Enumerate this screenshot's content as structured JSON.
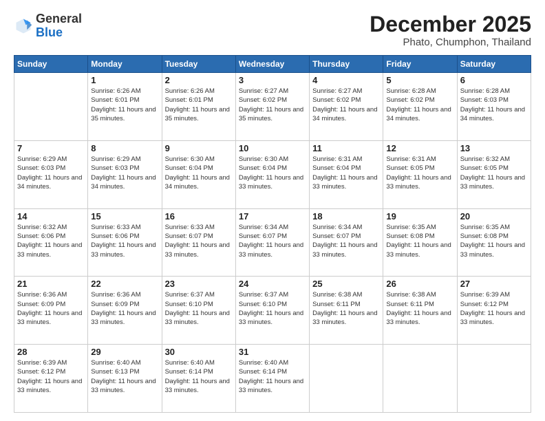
{
  "header": {
    "logo_general": "General",
    "logo_blue": "Blue",
    "month": "December 2025",
    "location": "Phato, Chumphon, Thailand"
  },
  "days_of_week": [
    "Sunday",
    "Monday",
    "Tuesday",
    "Wednesday",
    "Thursday",
    "Friday",
    "Saturday"
  ],
  "weeks": [
    [
      {
        "day": "",
        "sunrise": "",
        "sunset": "",
        "daylight": ""
      },
      {
        "day": "1",
        "sunrise": "Sunrise: 6:26 AM",
        "sunset": "Sunset: 6:01 PM",
        "daylight": "Daylight: 11 hours and 35 minutes."
      },
      {
        "day": "2",
        "sunrise": "Sunrise: 6:26 AM",
        "sunset": "Sunset: 6:01 PM",
        "daylight": "Daylight: 11 hours and 35 minutes."
      },
      {
        "day": "3",
        "sunrise": "Sunrise: 6:27 AM",
        "sunset": "Sunset: 6:02 PM",
        "daylight": "Daylight: 11 hours and 35 minutes."
      },
      {
        "day": "4",
        "sunrise": "Sunrise: 6:27 AM",
        "sunset": "Sunset: 6:02 PM",
        "daylight": "Daylight: 11 hours and 34 minutes."
      },
      {
        "day": "5",
        "sunrise": "Sunrise: 6:28 AM",
        "sunset": "Sunset: 6:02 PM",
        "daylight": "Daylight: 11 hours and 34 minutes."
      },
      {
        "day": "6",
        "sunrise": "Sunrise: 6:28 AM",
        "sunset": "Sunset: 6:03 PM",
        "daylight": "Daylight: 11 hours and 34 minutes."
      }
    ],
    [
      {
        "day": "7",
        "sunrise": "Sunrise: 6:29 AM",
        "sunset": "Sunset: 6:03 PM",
        "daylight": "Daylight: 11 hours and 34 minutes."
      },
      {
        "day": "8",
        "sunrise": "Sunrise: 6:29 AM",
        "sunset": "Sunset: 6:03 PM",
        "daylight": "Daylight: 11 hours and 34 minutes."
      },
      {
        "day": "9",
        "sunrise": "Sunrise: 6:30 AM",
        "sunset": "Sunset: 6:04 PM",
        "daylight": "Daylight: 11 hours and 34 minutes."
      },
      {
        "day": "10",
        "sunrise": "Sunrise: 6:30 AM",
        "sunset": "Sunset: 6:04 PM",
        "daylight": "Daylight: 11 hours and 33 minutes."
      },
      {
        "day": "11",
        "sunrise": "Sunrise: 6:31 AM",
        "sunset": "Sunset: 6:04 PM",
        "daylight": "Daylight: 11 hours and 33 minutes."
      },
      {
        "day": "12",
        "sunrise": "Sunrise: 6:31 AM",
        "sunset": "Sunset: 6:05 PM",
        "daylight": "Daylight: 11 hours and 33 minutes."
      },
      {
        "day": "13",
        "sunrise": "Sunrise: 6:32 AM",
        "sunset": "Sunset: 6:05 PM",
        "daylight": "Daylight: 11 hours and 33 minutes."
      }
    ],
    [
      {
        "day": "14",
        "sunrise": "Sunrise: 6:32 AM",
        "sunset": "Sunset: 6:06 PM",
        "daylight": "Daylight: 11 hours and 33 minutes."
      },
      {
        "day": "15",
        "sunrise": "Sunrise: 6:33 AM",
        "sunset": "Sunset: 6:06 PM",
        "daylight": "Daylight: 11 hours and 33 minutes."
      },
      {
        "day": "16",
        "sunrise": "Sunrise: 6:33 AM",
        "sunset": "Sunset: 6:07 PM",
        "daylight": "Daylight: 11 hours and 33 minutes."
      },
      {
        "day": "17",
        "sunrise": "Sunrise: 6:34 AM",
        "sunset": "Sunset: 6:07 PM",
        "daylight": "Daylight: 11 hours and 33 minutes."
      },
      {
        "day": "18",
        "sunrise": "Sunrise: 6:34 AM",
        "sunset": "Sunset: 6:07 PM",
        "daylight": "Daylight: 11 hours and 33 minutes."
      },
      {
        "day": "19",
        "sunrise": "Sunrise: 6:35 AM",
        "sunset": "Sunset: 6:08 PM",
        "daylight": "Daylight: 11 hours and 33 minutes."
      },
      {
        "day": "20",
        "sunrise": "Sunrise: 6:35 AM",
        "sunset": "Sunset: 6:08 PM",
        "daylight": "Daylight: 11 hours and 33 minutes."
      }
    ],
    [
      {
        "day": "21",
        "sunrise": "Sunrise: 6:36 AM",
        "sunset": "Sunset: 6:09 PM",
        "daylight": "Daylight: 11 hours and 33 minutes."
      },
      {
        "day": "22",
        "sunrise": "Sunrise: 6:36 AM",
        "sunset": "Sunset: 6:09 PM",
        "daylight": "Daylight: 11 hours and 33 minutes."
      },
      {
        "day": "23",
        "sunrise": "Sunrise: 6:37 AM",
        "sunset": "Sunset: 6:10 PM",
        "daylight": "Daylight: 11 hours and 33 minutes."
      },
      {
        "day": "24",
        "sunrise": "Sunrise: 6:37 AM",
        "sunset": "Sunset: 6:10 PM",
        "daylight": "Daylight: 11 hours and 33 minutes."
      },
      {
        "day": "25",
        "sunrise": "Sunrise: 6:38 AM",
        "sunset": "Sunset: 6:11 PM",
        "daylight": "Daylight: 11 hours and 33 minutes."
      },
      {
        "day": "26",
        "sunrise": "Sunrise: 6:38 AM",
        "sunset": "Sunset: 6:11 PM",
        "daylight": "Daylight: 11 hours and 33 minutes."
      },
      {
        "day": "27",
        "sunrise": "Sunrise: 6:39 AM",
        "sunset": "Sunset: 6:12 PM",
        "daylight": "Daylight: 11 hours and 33 minutes."
      }
    ],
    [
      {
        "day": "28",
        "sunrise": "Sunrise: 6:39 AM",
        "sunset": "Sunset: 6:12 PM",
        "daylight": "Daylight: 11 hours and 33 minutes."
      },
      {
        "day": "29",
        "sunrise": "Sunrise: 6:40 AM",
        "sunset": "Sunset: 6:13 PM",
        "daylight": "Daylight: 11 hours and 33 minutes."
      },
      {
        "day": "30",
        "sunrise": "Sunrise: 6:40 AM",
        "sunset": "Sunset: 6:14 PM",
        "daylight": "Daylight: 11 hours and 33 minutes."
      },
      {
        "day": "31",
        "sunrise": "Sunrise: 6:40 AM",
        "sunset": "Sunset: 6:14 PM",
        "daylight": "Daylight: 11 hours and 33 minutes."
      },
      {
        "day": "",
        "sunrise": "",
        "sunset": "",
        "daylight": ""
      },
      {
        "day": "",
        "sunrise": "",
        "sunset": "",
        "daylight": ""
      },
      {
        "day": "",
        "sunrise": "",
        "sunset": "",
        "daylight": ""
      }
    ]
  ]
}
